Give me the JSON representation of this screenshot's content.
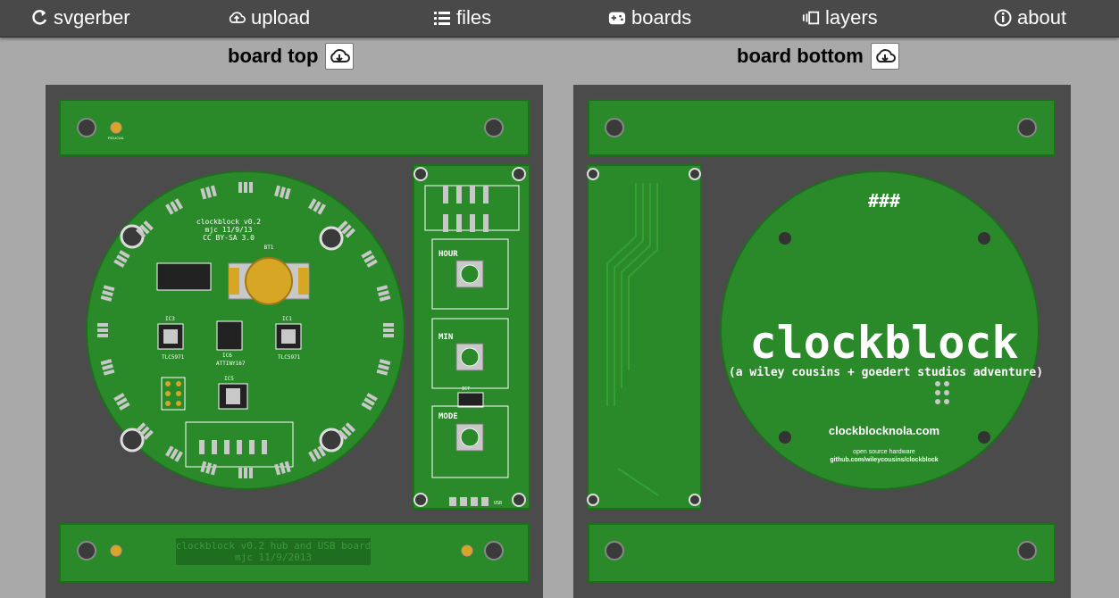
{
  "nav": {
    "brand": "svgerber",
    "upload": "upload",
    "files": "files",
    "boards": "boards",
    "layers": "layers",
    "about": "about"
  },
  "views": {
    "top_title": "board top",
    "bottom_title": "board bottom"
  },
  "top_board": {
    "silk_title": "clockblock v0.2",
    "silk_author": "mjc 11/9/13",
    "silk_license": "CC BY-SA 3.0",
    "hub_text_1": "clockblock v0.2 hub and USB board",
    "hub_text_2": "mjc 11/9/2013",
    "fiducial": "FIDUCIAL",
    "btn_hour": "HOUR",
    "btn_min": "MIN",
    "btn_mode": "MODE",
    "chip_ic3": "IC3",
    "chip_ic1": "IC1",
    "chip_ic6": "IC6",
    "chip_ic5": "IC5",
    "chip_ic7": "IC7",
    "chip_tlc": "TLC5971",
    "chip_attiny": "ATTINY167",
    "batt": "BT1",
    "usb": "USB"
  },
  "bottom_board": {
    "hash": "###",
    "name": "clockblock",
    "tagline": "(a wiley cousins + goedert studios adventure)",
    "url": "clockblocknola.com",
    "oss": "open source hardware",
    "repo": "github.com/wileycousins/clockblock"
  },
  "colors": {
    "pcb": "#2a8a2a",
    "pcb_dark": "#1f6e1f",
    "pcb_trace": "#33a033",
    "silk": "#ffffff",
    "pad": "#c8c8c8",
    "gold": "#d7a625",
    "panel": "#4b4b4b"
  }
}
